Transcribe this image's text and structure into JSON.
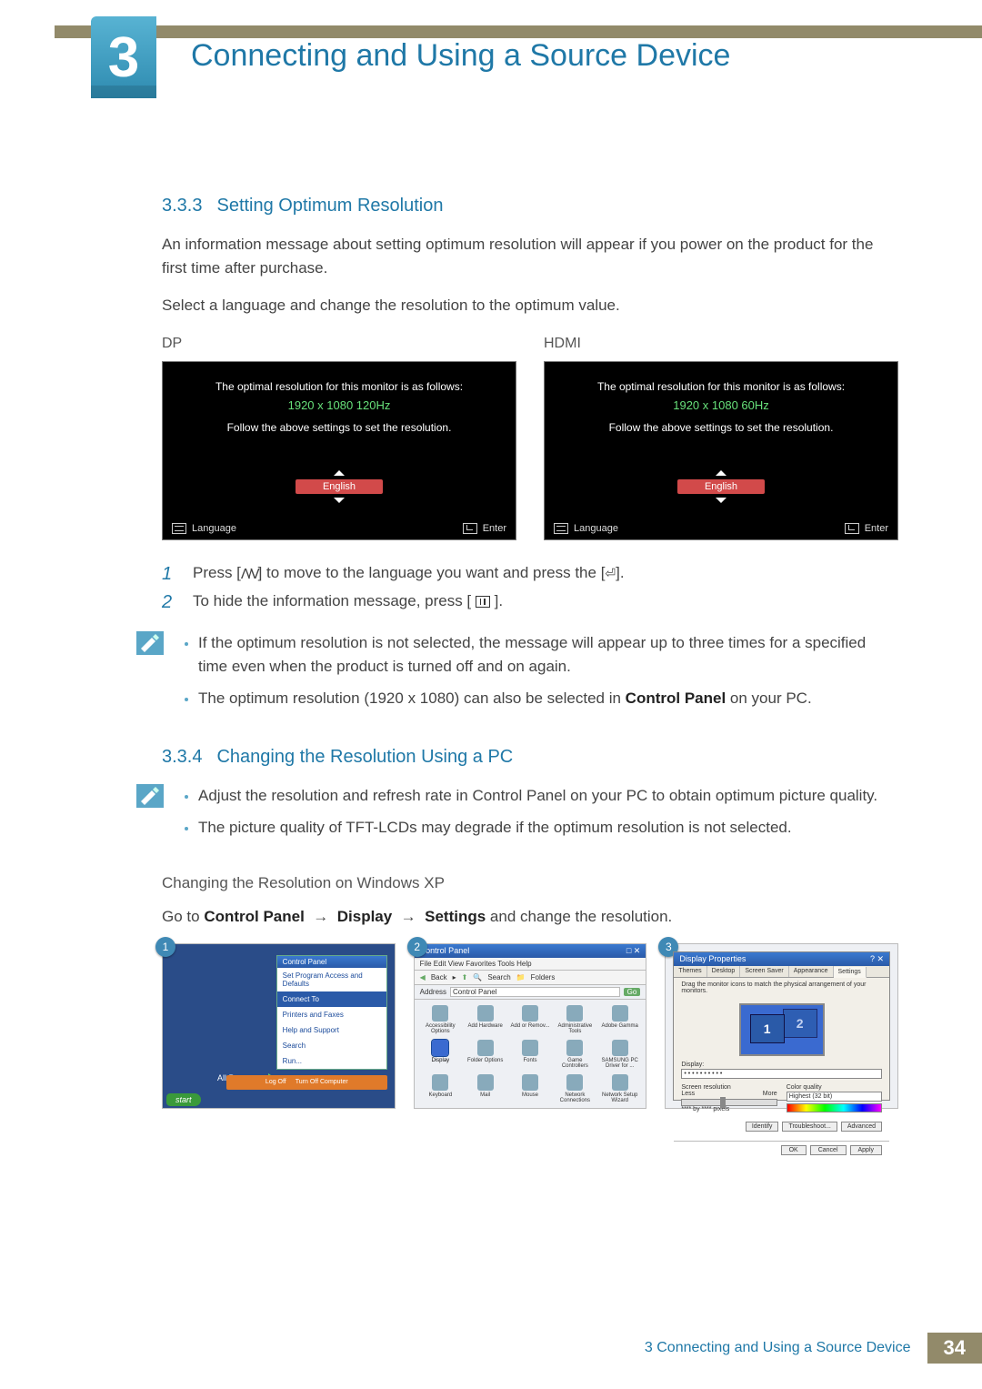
{
  "chapter": {
    "num": "3",
    "title": "Connecting and Using a Source Device"
  },
  "footer": {
    "label": "3 Connecting and Using a Source Device",
    "page": "34"
  },
  "s333": {
    "num": "3.3.3",
    "title": "Setting Optimum Resolution",
    "p1": "An information message about setting optimum resolution will appear if you power on the product for the first time after purchase.",
    "p2": "Select a language and change the resolution to the optimum value.",
    "dp_label": "DP",
    "hdmi_label": "HDMI",
    "osd": {
      "line1": "The optimal resolution for this monitor is as follows:",
      "dp_res": "1920 x 1080  120Hz",
      "hdmi_res": "1920 x 1080  60Hz",
      "line2": "Follow the above settings to set the resolution.",
      "lang": "English",
      "foot_lang": "Language",
      "foot_enter": "Enter"
    },
    "step1a": "Press [",
    "step1b": "] to move to the language you want and press the [",
    "step1c": "].",
    "step2a": "To hide the information message, press [",
    "step2b": "].",
    "note1": "If the optimum resolution is not selected, the message will appear up to three times for a specified time even when the product is turned off and on again.",
    "note2a": "The optimum resolution (1920 x 1080) can also be selected in ",
    "note2b": "Control Panel",
    "note2c": " on your PC."
  },
  "s334": {
    "num": "3.3.4",
    "title": "Changing the Resolution Using a PC",
    "note1": "Adjust the resolution and refresh rate in Control Panel on your PC to obtain optimum picture quality.",
    "note2": "The picture quality of TFT-LCDs may degrade if the optimum resolution is not selected.",
    "subhead": "Changing the Resolution on Windows XP",
    "patha": "Go to ",
    "cp": "Control Panel",
    "disp": "Display",
    "sett": "Settings",
    "pathz": " and change the resolution.",
    "step1num": "1",
    "step2num": "2",
    "step3num": "3",
    "xp1": {
      "header": "Control Panel",
      "items": [
        "Set Program Access and Defaults",
        "Connect To",
        "Printers and Faxes",
        "Help and Support",
        "Search",
        "Run..."
      ],
      "allprog": "All Programs",
      "logoff": "Log Off",
      "turnoff": "Turn Off Computer",
      "start": "start"
    },
    "xp2": {
      "title": "Control Panel",
      "menu": "File   Edit   View   Favorites   Tools   Help",
      "tool_back": "Back",
      "tool_search": "Search",
      "tool_folders": "Folders",
      "addr_label": "Address",
      "addr_val": "Control Panel",
      "go": "Go",
      "cells": [
        "Accessibility Options",
        "Add Hardware",
        "Add or Remov...",
        "Administrative Tools",
        "Adobe Gamma",
        "Display",
        "Folder Options",
        "Fonts",
        "Game Controllers",
        "SAMSUNG PC Driver for ...",
        "Keyboard",
        "Mail",
        "Mouse",
        "Network Connections",
        "Network Setup Wizard"
      ]
    },
    "xp3": {
      "title": "Display Properties",
      "tabs": [
        "Themes",
        "Desktop",
        "Screen Saver",
        "Appearance",
        "Settings"
      ],
      "hint": "Drag the monitor icons to match the physical arrangement of your monitors.",
      "m1": "1",
      "m2": "2",
      "display": "Display:",
      "displaydots": "• • • • • • • • • •",
      "screenres": "Screen resolution",
      "less": "Less",
      "more": "More",
      "resval": "**** by **** pixels",
      "colq": "Color quality",
      "colval": "Highest (32 bit)",
      "identify": "Identify",
      "troubleshoot": "Troubleshoot...",
      "advanced": "Advanced",
      "ok": "OK",
      "cancel": "Cancel",
      "apply": "Apply"
    }
  }
}
